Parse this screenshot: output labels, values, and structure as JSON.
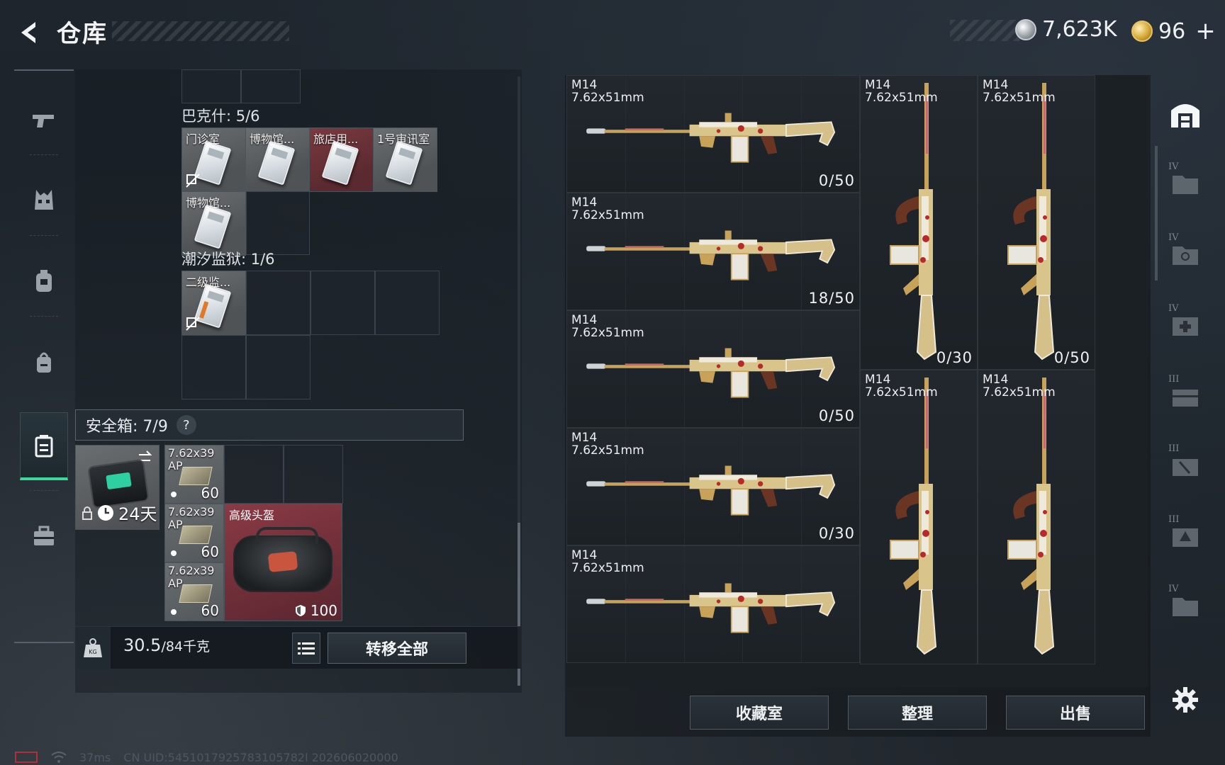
{
  "header": {
    "title": "仓库",
    "currency_silver": "7,623K",
    "currency_gold": "96",
    "plus_label": "+"
  },
  "left_nav": {
    "items": [
      "weapons-icon",
      "armor-icon",
      "backpack-icon",
      "bag-icon",
      "safe-case-icon",
      "toolbox-icon"
    ],
    "active_index": 4
  },
  "stash": {
    "section_bakesh": "巴克什: 5/6",
    "section_prison": "潮汐监狱: 1/6",
    "keys_bakesh": [
      {
        "name": "门诊室",
        "tint": "gray"
      },
      {
        "name": "博物馆...",
        "tint": "gray"
      },
      {
        "name": "旅店用...",
        "tint": "red"
      },
      {
        "name": "1号审讯室",
        "tint": "gray"
      },
      {
        "name": "博物馆...",
        "tint": "gray"
      }
    ],
    "keys_prison": [
      {
        "name": "二级监...",
        "tint": "gray"
      }
    ],
    "safe_box_label": "安全箱: 7/9",
    "help": "?",
    "case_timer": "24天",
    "ammo": [
      {
        "line1": "7.62x39",
        "line2": "AP",
        "count": "60"
      },
      {
        "line1": "7.62x39",
        "line2": "AP",
        "count": "60"
      },
      {
        "line1": "7.62x39",
        "line2": "AP",
        "count": "60"
      }
    ],
    "helmet": {
      "name": "高级头盔",
      "durability": "100"
    },
    "weight_value": "30.5",
    "weight_capacity": "/84千克",
    "transfer_all": "转移全部"
  },
  "weapons": {
    "horizontal": [
      {
        "name": "M14",
        "caliber": "7.62x51mm",
        "ammo": "0/50"
      },
      {
        "name": "M14",
        "caliber": "7.62x51mm",
        "ammo": "18/50"
      },
      {
        "name": "M14",
        "caliber": "7.62x51mm",
        "ammo": "0/50"
      },
      {
        "name": "M14",
        "caliber": "7.62x51mm",
        "ammo": "0/30"
      },
      {
        "name": "M14",
        "caliber": "7.62x51mm",
        "ammo": ""
      }
    ],
    "vertical": [
      {
        "name": "M14",
        "caliber": "7.62x51mm",
        "ammo": "0/30"
      },
      {
        "name": "M14",
        "caliber": "7.62x51mm",
        "ammo": "0/50"
      },
      {
        "name": "M14",
        "caliber": "7.62x51mm",
        "ammo": ""
      },
      {
        "name": "M14",
        "caliber": "7.62x51mm",
        "ammo": ""
      }
    ]
  },
  "actions": {
    "collection": "收藏室",
    "organize": "整理",
    "sell": "出售"
  },
  "right_nav": {
    "tiers": [
      "IV",
      "IV",
      "IV",
      "III",
      "III",
      "III",
      "IV"
    ]
  },
  "footer": {
    "ping": "37ms",
    "uid": "CN UID:5451017925783105782l 202606020000"
  },
  "colors": {
    "accent_green": "#3dd89a",
    "red_slot": "#7a3a40",
    "gold_accent": "#c9a25a"
  }
}
